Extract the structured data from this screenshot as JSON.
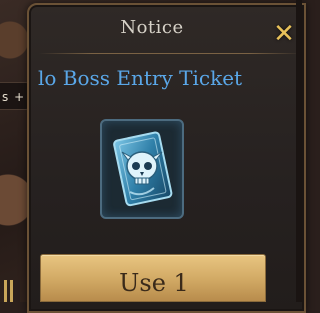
{
  "background": {
    "left_tab_fragment": "s",
    "left_tab_plus": "+"
  },
  "dialog": {
    "title": "Notice",
    "close_icon": "close-icon",
    "item_name": "lo Boss Entry Ticket",
    "item_icon": "skull-ticket-icon",
    "use_button_label": "Use 1"
  },
  "colors": {
    "title": "#d7d2c8",
    "close": "#e9c25a",
    "item_name": "#5aa7e8",
    "button_gold": "#d3ab66",
    "button_text": "#3a2a1a"
  }
}
